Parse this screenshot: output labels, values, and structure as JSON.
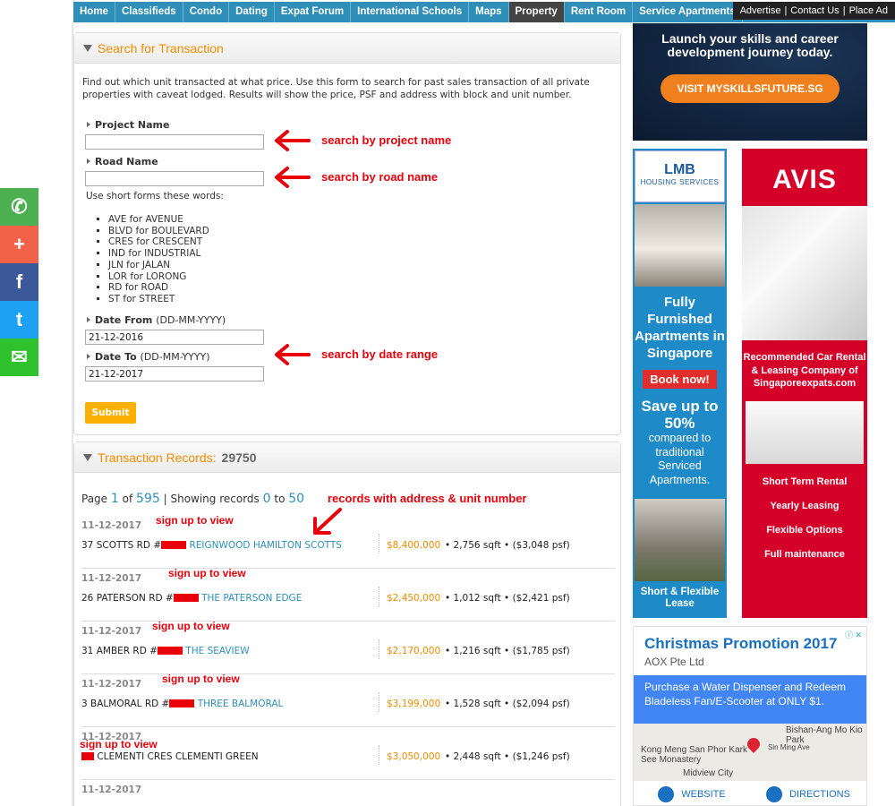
{
  "nav": {
    "items": [
      "Home",
      "Classifieds",
      "Condo",
      "Dating",
      "Expat Forum",
      "International Schools",
      "Maps",
      "Property",
      "Rent Room",
      "Service Apartments"
    ],
    "active": "Property",
    "top_links": [
      "Advertise",
      "Contact Us",
      "Place Ad"
    ],
    "accent_color": "#2f8fb8"
  },
  "social": {
    "buttons": [
      {
        "icon": "whatsapp-icon",
        "glyph": "✆",
        "color": "#4caf50"
      },
      {
        "icon": "plus-icon",
        "glyph": "+",
        "color": "#f26248"
      },
      {
        "icon": "facebook-icon",
        "glyph": "f",
        "color": "#3b5998"
      },
      {
        "icon": "twitter-icon",
        "glyph": "t",
        "color": "#1da1f2"
      },
      {
        "icon": "wechat-icon",
        "glyph": "✉",
        "color": "#30c12e"
      }
    ]
  },
  "search": {
    "title": "Search for Transaction",
    "intro": "Find out which unit transacted at what price. Use this form to search for past sales transaction of all private properties with caveat lodged. Results will show the price, PSF and address with block and unit number.",
    "project_label": "Project Name",
    "project_value": "",
    "road_label": "Road Name",
    "road_value": "",
    "short_forms_note": "Use short forms these words:",
    "abbreviations": [
      "AVE for AVENUE",
      "BLVD for BOULEVARD",
      "CRES for CRESCENT",
      "IND for INDUSTRIAL",
      "JLN for JALAN",
      "LOR for LORONG",
      "RD for ROAD",
      "ST for STREET"
    ],
    "date_from_label": "Date From",
    "date_to_label": "Date To",
    "date_format_hint": "(DD-MM-YYYY)",
    "date_from_value": "21-12-2016",
    "date_to_value": "21-12-2017",
    "submit_label": "Submit"
  },
  "annotations": {
    "project": "search by project name",
    "road": "search by road name",
    "date": "search by date range",
    "records": "records with address & unit number",
    "sign_up": "sign up to view"
  },
  "records": {
    "title": "Transaction Records:",
    "total": "29750",
    "page_label": "Page",
    "page": "1",
    "of_label": "of",
    "pages": "595",
    "showing_label": "| Showing records",
    "from": "0",
    "to_label": "to",
    "to": "50",
    "rows": [
      {
        "date": "11-12-2017",
        "address": "37 SCOTTS RD #",
        "project": "REIGNWOOD HAMILTON SCOTTS",
        "price": "$8,400,000",
        "size": "2,756 sqft",
        "psf": "($3,048 psf)"
      },
      {
        "date": "11-12-2017",
        "address": "26 PATERSON RD #",
        "project": "THE PATERSON EDGE",
        "price": "$2,450,000",
        "size": "1,012 sqft",
        "psf": "($2,421 psf)"
      },
      {
        "date": "11-12-2017",
        "address": "31 AMBER RD #",
        "project": "THE SEAVIEW",
        "price": "$2,170,000",
        "size": "1,216 sqft",
        "psf": "($1,785 psf)"
      },
      {
        "date": "11-12-2017",
        "address": "3 BALMORAL RD #",
        "project": "THREE BALMORAL",
        "price": "$3,199,000",
        "size": "1,528 sqft",
        "psf": "($2,094 psf)"
      },
      {
        "date": "11-12-2017",
        "address": "CLEMENTI CRES CLEMENTI GREEN",
        "project": "",
        "price": "$3,050,000",
        "size": "2,448 sqft",
        "psf": "($1,246 psf)"
      },
      {
        "date": "11-12-2017",
        "address": "",
        "project": "",
        "price": "",
        "size": "",
        "psf": ""
      }
    ]
  },
  "ads": {
    "skills": {
      "text": "Launch your skills and career development journey today.",
      "button": "VISIT MYSKILLSFUTURE.SG"
    },
    "lmb": {
      "logo_main": "LMB",
      "logo_sub": "HOUSING SERVICES",
      "headline": "Fully Furnished Apartments in Singapore",
      "book": "Book now!",
      "save": "Save up to 50%",
      "sub": "compared to traditional Serviced Apartments.",
      "footer": "Short & Flexible Lease"
    },
    "avis": {
      "logo": "AVIS",
      "recommended": "Recommended Car Rental & Leasing Company of Singaporeexpats.com",
      "services": [
        "Short Term Rental",
        "Yearly Leasing",
        "Flexible Options",
        "Full maintenance"
      ]
    },
    "aox": {
      "title": "Christmas Promotion 2017",
      "company": "AOX Pte Ltd",
      "blurb": "Purchase a Water Dispenser and Redeem Bladeless Fan/E-Scooter at ONLY $1.",
      "map_labels": [
        "Kong Meng San Phor Kark See Monastery",
        "Bishan-Ang Mo Kio Park",
        "Midview City",
        "Sin Ming Ave"
      ],
      "website": "WEBSITE",
      "directions": "DIRECTIONS"
    }
  }
}
